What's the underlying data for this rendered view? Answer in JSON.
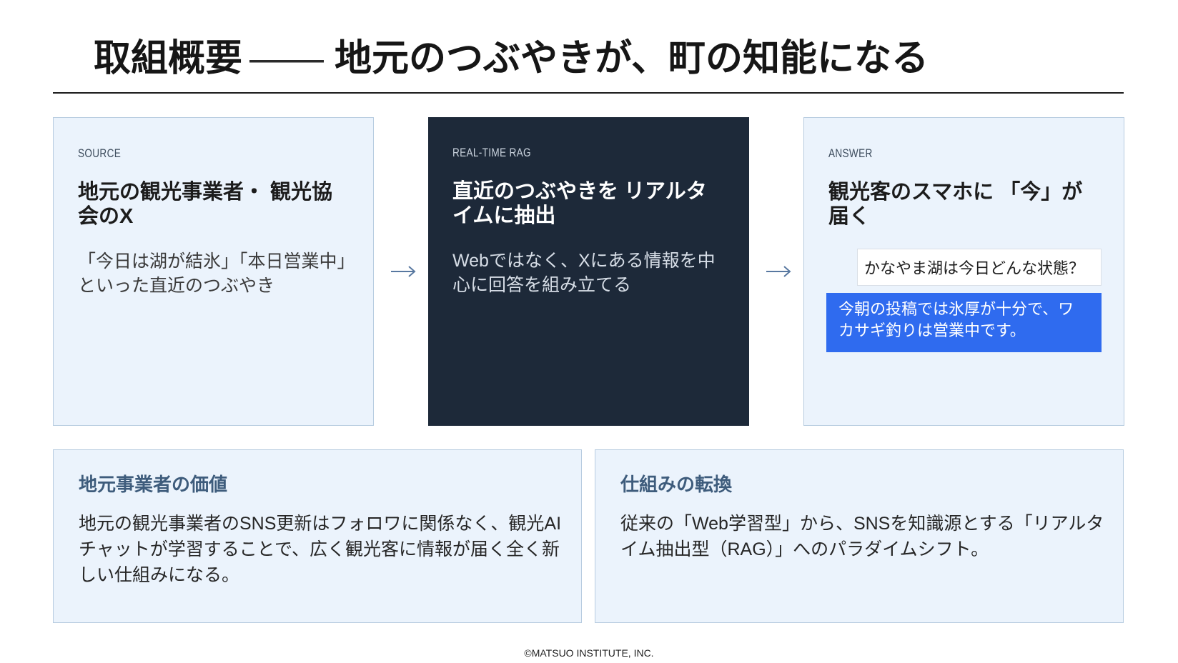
{
  "title": {
    "main": "取組概要",
    "dash": "——",
    "sub": "地元のつぶやきが、町の知能になる"
  },
  "flow": [
    {
      "label": "SOURCE",
      "heading": "地元の観光事業者・ 観光協会のX",
      "body": "「今日は湖が結氷」「本日営業中」といった直近のつぶやき"
    },
    {
      "label": "REAL-TIME RAG",
      "heading": "直近のつぶやきを リアルタイムに抽出",
      "body": "Webではなく、Xにある情報を中心に回答を組み立てる"
    },
    {
      "label": "ANSWER",
      "heading": "観光客のスマホに 「今」が届く",
      "chat": {
        "question": "かなやま湖は今日どんな状態？",
        "answer": "今朝の投稿では氷厚が十分で、ワカサギ釣りは営業中です。"
      }
    }
  ],
  "icons": {
    "flow_arrow": "arrow-right-icon"
  },
  "panels": [
    {
      "heading": "地元事業者の価値",
      "body": "地元の観光事業者のSNS更新はフォロワに関係なく、観光AIチャットが学習することで、広く観光客に情報が届く全く新しい仕組みになる。"
    },
    {
      "heading": "仕組みの転換",
      "body": "従来の「Web学習型」から、SNSを知識源とする「リアルタイム抽出型（RAG）」へのパラダイムシフト。"
    }
  ],
  "footer": "©MATSUO INSTITUTE, INC.",
  "colors": {
    "light_card": "#ebf3fc",
    "dark_card": "#1d2939",
    "answer_bubble": "#2f6bef",
    "panel_heading": "#3e5c7c",
    "arrow": "#5878a0"
  }
}
